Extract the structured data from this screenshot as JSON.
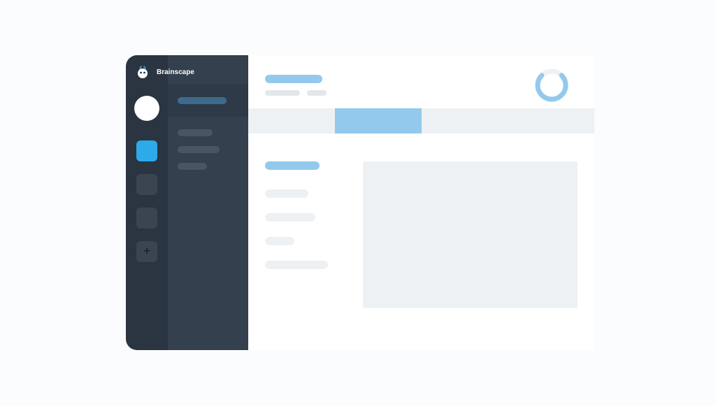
{
  "brand": {
    "name": "Brainscape"
  },
  "icons": {
    "add": "+"
  }
}
